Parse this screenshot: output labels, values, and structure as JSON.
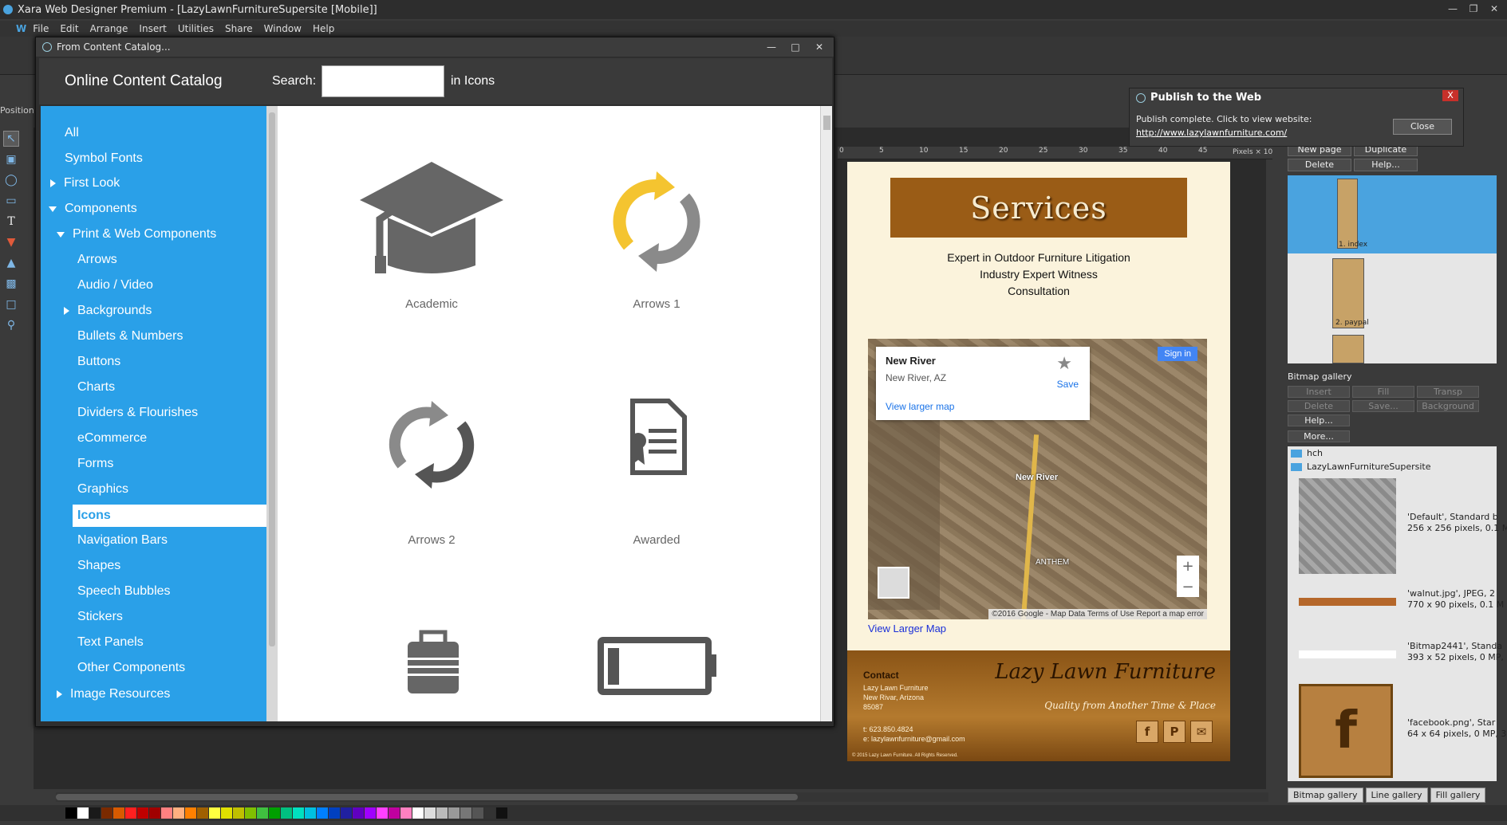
{
  "app": {
    "title": "Xara Web Designer Premium - [LazyLawnFurnitureSupersite [Mobile]]",
    "menu": [
      "W",
      "File",
      "Edit",
      "Arrange",
      "Insert",
      "Utilities",
      "Share",
      "Window",
      "Help"
    ],
    "position_label": "Position"
  },
  "ruler": {
    "ticks": [
      "0",
      "5",
      "10",
      "15",
      "20",
      "25",
      "30",
      "35",
      "40",
      "45"
    ],
    "units": "Pixels × 10"
  },
  "catalog": {
    "window_title": "From Content Catalog...",
    "heading": "Online Content Catalog",
    "search_label": "Search:",
    "search_value": "",
    "in_label": "in Icons",
    "nav": [
      {
        "label": "All"
      },
      {
        "label": "Symbol Fonts"
      },
      {
        "label": "First Look"
      },
      {
        "label": "Components"
      },
      {
        "label": "Print & Web Components"
      },
      {
        "label": "Arrows"
      },
      {
        "label": "Audio / Video"
      },
      {
        "label": "Backgrounds"
      },
      {
        "label": "Bullets & Numbers"
      },
      {
        "label": "Buttons"
      },
      {
        "label": "Charts"
      },
      {
        "label": "Dividers & Flourishes"
      },
      {
        "label": "eCommerce"
      },
      {
        "label": "Forms"
      },
      {
        "label": "Graphics"
      },
      {
        "label": "Icons"
      },
      {
        "label": "Navigation Bars"
      },
      {
        "label": "Shapes"
      },
      {
        "label": "Speech Bubbles"
      },
      {
        "label": "Stickers"
      },
      {
        "label": "Text Panels"
      },
      {
        "label": "Other Components"
      },
      {
        "label": "Image Resources"
      }
    ],
    "selected": "Icons",
    "tiles": [
      {
        "label": "Academic",
        "icon": "graduation-cap-icon"
      },
      {
        "label": "Arrows 1",
        "icon": "refresh-arrows-icon"
      },
      {
        "label": "Arrows 2",
        "icon": "cycle-arrows-icon"
      },
      {
        "label": "Awarded",
        "icon": "certificate-document-icon"
      },
      {
        "label": "",
        "icon": "briefcase-icon"
      },
      {
        "label": "",
        "icon": "battery-icon"
      }
    ]
  },
  "publish": {
    "title": "Publish to the Web",
    "message": "Publish complete. Click to view website:",
    "url": "http://www.lazylawnfurniture.com/",
    "close_button": "Close",
    "close_x": "X"
  },
  "site": {
    "services_heading": "Services",
    "services": [
      "Expert in Outdoor Furniture Litigation",
      "Industry Expert Witness",
      "Consultation"
    ],
    "map": {
      "place_name": "New River",
      "place_address": "New River, AZ",
      "larger_map": "View larger map",
      "save": "Save",
      "signin": "Sign in",
      "label_town": "New River",
      "label_area": "ANTHEM",
      "credits": "©2016 Google - Map Data   Terms of Use   Report a map error",
      "google": "Google"
    },
    "view_larger_map": "View Larger Map",
    "footer": {
      "contact_heading": "Contact",
      "contact_lines": [
        "Lazy Lawn Furniture",
        "New Rivar, Arizona",
        "85087",
        "",
        "t: 623.850.4824",
        "e: lazylawnfurniture@gmail.com"
      ],
      "brand": "Lazy Lawn Furniture",
      "tagline": "Quality from Another Time & Place",
      "copyright": "© 2015 Lazy Lawn Furniture. All Rights Reserved."
    }
  },
  "pages_panel": {
    "buttons": [
      "New page",
      "Duplicate",
      "Delete",
      "Help..."
    ],
    "pages": [
      {
        "label": "1. index"
      },
      {
        "label": "2. paypal"
      }
    ]
  },
  "bitmap_gallery": {
    "title": "Bitmap gallery",
    "buttons": [
      "Insert",
      "Fill",
      "Transp",
      "Delete",
      "Save...",
      "Background",
      "Help...",
      "More..."
    ],
    "folders": [
      "hch",
      "LazyLawnFurnitureSupersite"
    ],
    "items": [
      {
        "line1": "'Default',  Standard b",
        "line2": "256 x 256 pixels, 0.1 M"
      },
      {
        "line1": "'walnut.jpg',  JPEG,  2",
        "line2": "770 x 90 pixels, 0.1 M"
      },
      {
        "line1": "'Bitmap2441',  Standa",
        "line2": "393 x 52 pixels, 0 MP,"
      },
      {
        "line1": "'facebook.png',  Star",
        "line2": "64 x 64 pixels, 0 MP, 3"
      }
    ],
    "tabs": [
      "Bitmap gallery",
      "Line gallery",
      "Fill gallery"
    ]
  },
  "colors": {
    "accent": "#2aa0e8",
    "brand_brown": "#9a5c16",
    "page_bg": "#fbf3dc"
  },
  "palette": [
    "#000000",
    "#ffffff",
    "#1a1a1a",
    "#7a2a00",
    "#d85a00",
    "#ff2020",
    "#c00000",
    "#a00000",
    "#ff8080",
    "#ffb080",
    "#ff8000",
    "#a06000",
    "#ffff40",
    "#e0e000",
    "#c0c000",
    "#80c000",
    "#40c040",
    "#00a000",
    "#00c080",
    "#00e0c0",
    "#00c0e0",
    "#0080ff",
    "#0040c0",
    "#2020a0",
    "#6000c0",
    "#a000ff",
    "#ff40ff",
    "#c000a0",
    "#ff80c0",
    "#ffffff",
    "#dddddd",
    "#bbbbbb",
    "#999999",
    "#777777",
    "#555555",
    "#333333",
    "#111111"
  ]
}
